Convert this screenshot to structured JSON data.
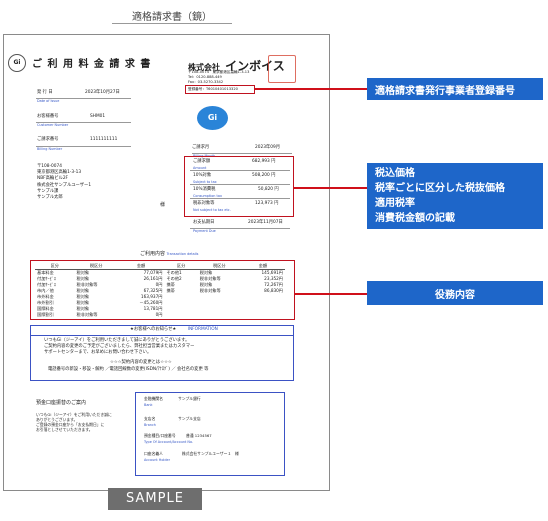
{
  "page_title": "適格請求書（鏡）",
  "sample_label": "SAMPLE",
  "doc": {
    "logo": "Gi",
    "title": "ご 利 用 料 金 請 求 書",
    "company": {
      "name_prefix": "株式会社",
      "name_main": "インボイス",
      "address": "〒108-0074　東京都港区高輪1-3-13",
      "tel": "Tel：0120-888-449",
      "fax": "Fax：03-5270-3342",
      "reg_number": "登録番号：T6010401013320"
    },
    "issue_date": {
      "label": "発 行 日",
      "value": "2023年10月27日",
      "en": "Date of Issue"
    },
    "customer_no": {
      "label": "お客様番号",
      "value": "SHM01",
      "en": "Customer Number"
    },
    "billing_no": {
      "label": "ご請求番号",
      "value": "1111111111",
      "en": "Billing Number"
    },
    "addressee": [
      "〒108-0074",
      "東京都港区高輪1-3-13",
      "NBF高輪ビル2F",
      "株式会社サンプルユーザー1",
      "サンプル課",
      "サンプル太郎"
    ],
    "honorific": "様",
    "billing_month": {
      "label": "ご請求月",
      "value": "2023年09月",
      "en": "Billing Month"
    },
    "gi_circle": "Gi",
    "amounts": [
      {
        "label": "ご請求額",
        "value": "682,993 円",
        "en": "Amount"
      },
      {
        "label": "10%対象",
        "value": "508,200 円",
        "en": "Subject to tax"
      },
      {
        "label": "10%消費税",
        "value": "50,820 円",
        "en": "Consumption tax"
      },
      {
        "label": "税非対象等",
        "value": "123,973 円",
        "en": "Not subject to tax etc."
      }
    ],
    "due_date": {
      "label": "お支払期日",
      "value": "2023年11月07日",
      "en": "Payment Due"
    },
    "detail_title": "ご利用内容",
    "detail_title_en": "Transaction details",
    "detail_headers": [
      "区分",
      "税区分",
      "金額",
      "区分",
      "税区分",
      "金額"
    ],
    "detail_rows": [
      [
        "基本料金",
        "税対象",
        "77,079円",
        "その他1",
        "税対象",
        "145,691円"
      ],
      [
        "付加ｻｰﾋﾞｽ",
        "税対象",
        "26,161円",
        "その他2",
        "税非対象等",
        "23,352円"
      ],
      [
        "付加ｻｰﾋﾞｽ",
        "税非対象等",
        "0円",
        "携帯",
        "税対象",
        "72,267円"
      ],
      [
        "市内／他",
        "税対象",
        "67,325円",
        "携帯",
        "税非対象等",
        "86,830円"
      ],
      [
        "市外料金",
        "税対象",
        "163,937円",
        "",
        "",
        ""
      ],
      [
        "市外割引",
        "税対象",
        "－45,260円",
        "",
        "",
        ""
      ],
      [
        "国際料金",
        "税対象",
        "13,781円",
        "",
        "",
        ""
      ],
      [
        "国際割引",
        "税非対象等",
        "0円",
        "",
        "",
        ""
      ]
    ],
    "info_title": "★お客様へのお知らせ★",
    "info_title_en": "INFORMATION",
    "info_lines": [
      "いつもGi（ジーアイ）をご利用いただきまして誠にありがとうございます。",
      "ご契約内容の変更のご予定がございましたら、弊社担当営業またはカスタマー",
      "サポートセンターまで、お早めにお問い合わせ下さい。",
      "☆☆☆契約内容の変更とは☆☆☆",
      "電話番号の新設・移設・解約 ／電話回線数の変更(ISDN/ｱﾅﾛｸﾞ) ／ 会社名の変更 等"
    ],
    "bank_title": "預金口座振替のご案内",
    "bank_text": [
      "いつもGi（ジーアイ）をご利用いただき誠に",
      "ありがとうございます。",
      "ご登録の預金口座から「お支払期日」に",
      "お引落としさせていただきます。"
    ],
    "bank_rows": [
      {
        "label": "金融機関名",
        "value": "サンプル銀行",
        "en": "Bank"
      },
      {
        "label": "支店名",
        "value": "サンプル支店",
        "en": "Branch"
      },
      {
        "label": "預金種目/口座番号",
        "value": "普通 1234567",
        "en": "Type Of Account/Account No."
      },
      {
        "label": "口座名義人",
        "value": "株式会社サンプルユーザー１　様",
        "en": "Account Holder"
      }
    ]
  },
  "callouts": [
    {
      "lines": [
        "適格請求書発行事業者登録番号"
      ]
    },
    {
      "lines": [
        "税込価格",
        "税率ごとに区分した税抜価格",
        "適用税率",
        "消費税金額の記載"
      ]
    },
    {
      "lines": [
        "役務内容"
      ]
    }
  ],
  "colors": {
    "callout_blue": "#1e66c9",
    "highlight_red": "#c0121f",
    "link_blue": "#3557c6"
  }
}
